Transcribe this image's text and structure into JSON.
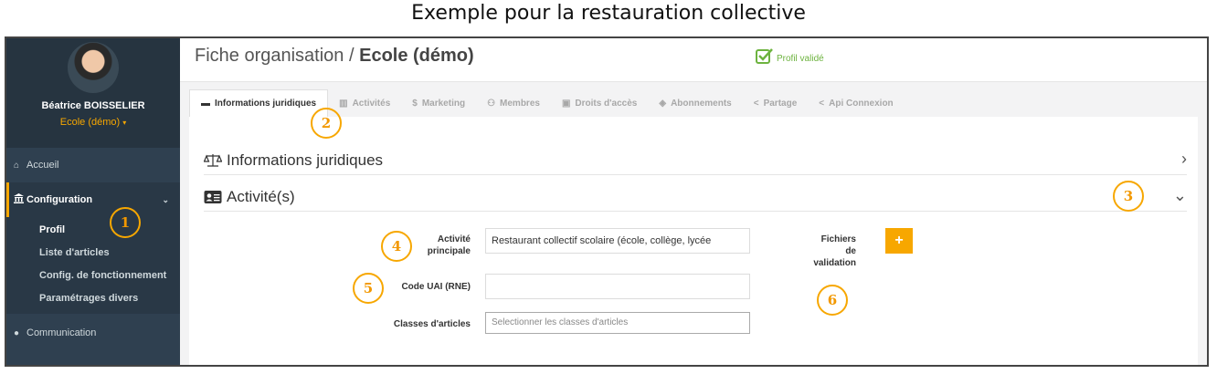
{
  "caption": "Exemple pour la restauration collective",
  "user": {
    "name": "Béatrice BOISSELIER",
    "org": "Ecole (démo)",
    "org_caret": "▾"
  },
  "nav": {
    "home": "Accueil",
    "config": "Configuration",
    "sub_items": [
      "Profil",
      "Liste d'articles",
      "Config. de fonctionnement",
      "Paramétrages divers"
    ],
    "communication": "Communication"
  },
  "header": {
    "title_prefix": "Fiche organisation / ",
    "title_bold": "Ecole (démo)",
    "status": "Profil validé"
  },
  "tabs": [
    {
      "label": "Informations juridiques",
      "icon": "folder-open-icon"
    },
    {
      "label": "Activités",
      "icon": "bar-chart-icon"
    },
    {
      "label": "Marketing",
      "icon": "dollar-icon"
    },
    {
      "label": "Membres",
      "icon": "users-icon"
    },
    {
      "label": "Droits d'accès",
      "icon": "lock-icon"
    },
    {
      "label": "Abonnements",
      "icon": "tag-icon"
    },
    {
      "label": "Partage",
      "icon": "share-icon"
    },
    {
      "label": "Api Connexion",
      "icon": "share-icon"
    }
  ],
  "sections": {
    "legal": {
      "title": "Informations juridiques",
      "arrow": "›"
    },
    "activity": {
      "title": "Activité(s)",
      "arrow": "⌄"
    }
  },
  "form": {
    "main_activity_label_1": "Activité",
    "main_activity_label_2": "principale",
    "main_activity_value": "Restaurant collectif scolaire (école, collège, lycée",
    "uai_label": "Code UAI (RNE)",
    "uai_value": "",
    "classes_label": "Classes d'articles",
    "classes_placeholder": "Selectionner les classes d'articles",
    "files_label_1": "Fichiers",
    "files_label_2": "de",
    "files_label_3": "validation",
    "add_label": "+"
  },
  "markers": [
    "1",
    "2",
    "3",
    "4",
    "5",
    "6"
  ],
  "colors": {
    "accent": "#f7a700",
    "sidebar": "#2f4050",
    "valid": "#6db33f"
  }
}
